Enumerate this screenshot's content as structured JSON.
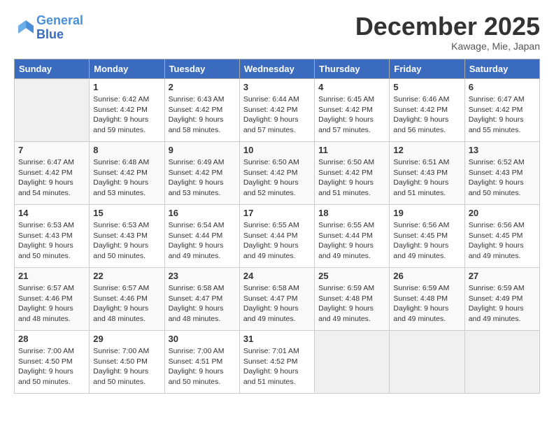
{
  "header": {
    "logo_line1": "General",
    "logo_line2": "Blue",
    "month": "December 2025",
    "location": "Kawage, Mie, Japan"
  },
  "weekdays": [
    "Sunday",
    "Monday",
    "Tuesday",
    "Wednesday",
    "Thursday",
    "Friday",
    "Saturday"
  ],
  "weeks": [
    [
      {
        "day": "",
        "info": ""
      },
      {
        "day": "1",
        "info": "Sunrise: 6:42 AM\nSunset: 4:42 PM\nDaylight: 9 hours\nand 59 minutes."
      },
      {
        "day": "2",
        "info": "Sunrise: 6:43 AM\nSunset: 4:42 PM\nDaylight: 9 hours\nand 58 minutes."
      },
      {
        "day": "3",
        "info": "Sunrise: 6:44 AM\nSunset: 4:42 PM\nDaylight: 9 hours\nand 57 minutes."
      },
      {
        "day": "4",
        "info": "Sunrise: 6:45 AM\nSunset: 4:42 PM\nDaylight: 9 hours\nand 57 minutes."
      },
      {
        "day": "5",
        "info": "Sunrise: 6:46 AM\nSunset: 4:42 PM\nDaylight: 9 hours\nand 56 minutes."
      },
      {
        "day": "6",
        "info": "Sunrise: 6:47 AM\nSunset: 4:42 PM\nDaylight: 9 hours\nand 55 minutes."
      }
    ],
    [
      {
        "day": "7",
        "info": "Sunrise: 6:47 AM\nSunset: 4:42 PM\nDaylight: 9 hours\nand 54 minutes."
      },
      {
        "day": "8",
        "info": "Sunrise: 6:48 AM\nSunset: 4:42 PM\nDaylight: 9 hours\nand 53 minutes."
      },
      {
        "day": "9",
        "info": "Sunrise: 6:49 AM\nSunset: 4:42 PM\nDaylight: 9 hours\nand 53 minutes."
      },
      {
        "day": "10",
        "info": "Sunrise: 6:50 AM\nSunset: 4:42 PM\nDaylight: 9 hours\nand 52 minutes."
      },
      {
        "day": "11",
        "info": "Sunrise: 6:50 AM\nSunset: 4:42 PM\nDaylight: 9 hours\nand 51 minutes."
      },
      {
        "day": "12",
        "info": "Sunrise: 6:51 AM\nSunset: 4:43 PM\nDaylight: 9 hours\nand 51 minutes."
      },
      {
        "day": "13",
        "info": "Sunrise: 6:52 AM\nSunset: 4:43 PM\nDaylight: 9 hours\nand 50 minutes."
      }
    ],
    [
      {
        "day": "14",
        "info": "Sunrise: 6:53 AM\nSunset: 4:43 PM\nDaylight: 9 hours\nand 50 minutes."
      },
      {
        "day": "15",
        "info": "Sunrise: 6:53 AM\nSunset: 4:43 PM\nDaylight: 9 hours\nand 50 minutes."
      },
      {
        "day": "16",
        "info": "Sunrise: 6:54 AM\nSunset: 4:44 PM\nDaylight: 9 hours\nand 49 minutes."
      },
      {
        "day": "17",
        "info": "Sunrise: 6:55 AM\nSunset: 4:44 PM\nDaylight: 9 hours\nand 49 minutes."
      },
      {
        "day": "18",
        "info": "Sunrise: 6:55 AM\nSunset: 4:44 PM\nDaylight: 9 hours\nand 49 minutes."
      },
      {
        "day": "19",
        "info": "Sunrise: 6:56 AM\nSunset: 4:45 PM\nDaylight: 9 hours\nand 49 minutes."
      },
      {
        "day": "20",
        "info": "Sunrise: 6:56 AM\nSunset: 4:45 PM\nDaylight: 9 hours\nand 49 minutes."
      }
    ],
    [
      {
        "day": "21",
        "info": "Sunrise: 6:57 AM\nSunset: 4:46 PM\nDaylight: 9 hours\nand 48 minutes."
      },
      {
        "day": "22",
        "info": "Sunrise: 6:57 AM\nSunset: 4:46 PM\nDaylight: 9 hours\nand 48 minutes."
      },
      {
        "day": "23",
        "info": "Sunrise: 6:58 AM\nSunset: 4:47 PM\nDaylight: 9 hours\nand 48 minutes."
      },
      {
        "day": "24",
        "info": "Sunrise: 6:58 AM\nSunset: 4:47 PM\nDaylight: 9 hours\nand 49 minutes."
      },
      {
        "day": "25",
        "info": "Sunrise: 6:59 AM\nSunset: 4:48 PM\nDaylight: 9 hours\nand 49 minutes."
      },
      {
        "day": "26",
        "info": "Sunrise: 6:59 AM\nSunset: 4:48 PM\nDaylight: 9 hours\nand 49 minutes."
      },
      {
        "day": "27",
        "info": "Sunrise: 6:59 AM\nSunset: 4:49 PM\nDaylight: 9 hours\nand 49 minutes."
      }
    ],
    [
      {
        "day": "28",
        "info": "Sunrise: 7:00 AM\nSunset: 4:50 PM\nDaylight: 9 hours\nand 50 minutes."
      },
      {
        "day": "29",
        "info": "Sunrise: 7:00 AM\nSunset: 4:50 PM\nDaylight: 9 hours\nand 50 minutes."
      },
      {
        "day": "30",
        "info": "Sunrise: 7:00 AM\nSunset: 4:51 PM\nDaylight: 9 hours\nand 50 minutes."
      },
      {
        "day": "31",
        "info": "Sunrise: 7:01 AM\nSunset: 4:52 PM\nDaylight: 9 hours\nand 51 minutes."
      },
      {
        "day": "",
        "info": ""
      },
      {
        "day": "",
        "info": ""
      },
      {
        "day": "",
        "info": ""
      }
    ]
  ]
}
